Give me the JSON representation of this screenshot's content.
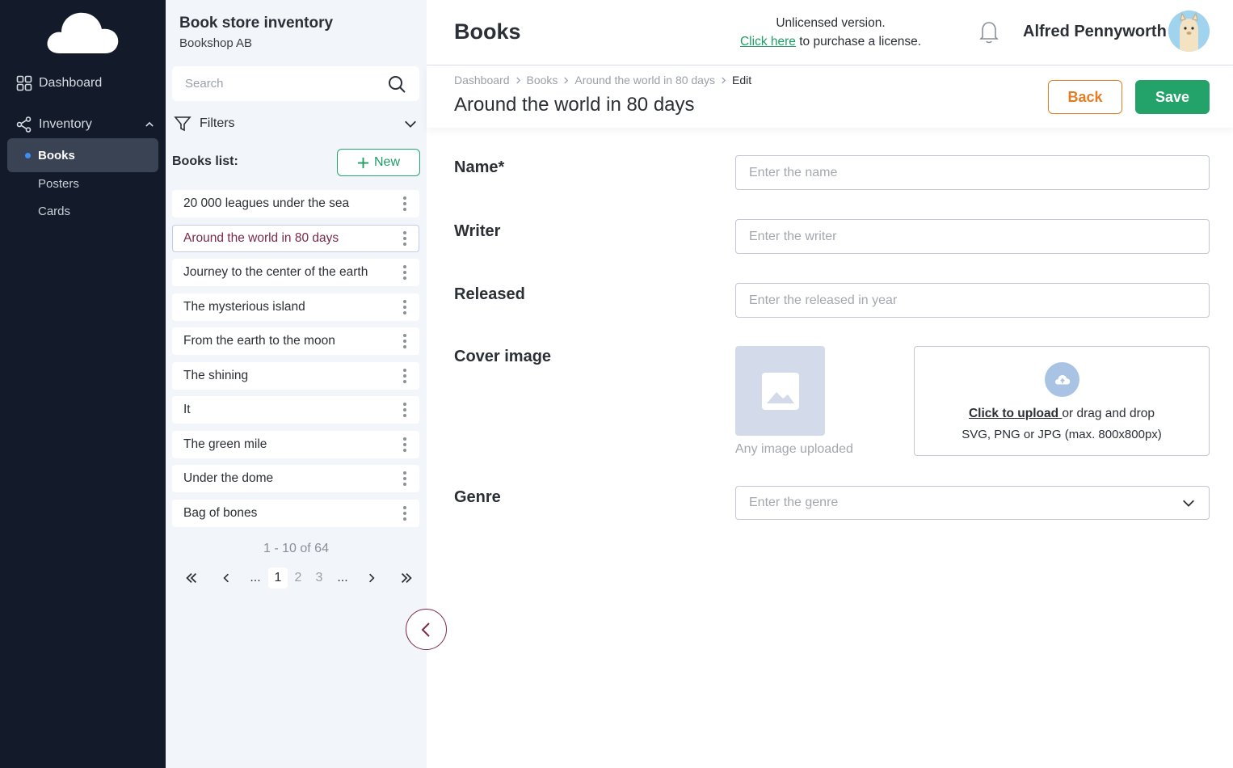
{
  "sidebar": {
    "logo_icon": "cloud-icon",
    "dashboard_label": "Dashboard",
    "inventory_label": "Inventory",
    "sub_items": [
      {
        "label": "Books",
        "active": true
      },
      {
        "label": "Posters",
        "active": false
      },
      {
        "label": "Cards",
        "active": false
      }
    ]
  },
  "list_panel": {
    "title": "Book store inventory",
    "subtitle": "Bookshop AB",
    "search_placeholder": "Search",
    "filters_label": "Filters",
    "list_label": "Books list:",
    "new_label": "New",
    "books": [
      {
        "title": "20 000 leagues under the sea",
        "selected": false
      },
      {
        "title": "Around the world in 80 days",
        "selected": true
      },
      {
        "title": "Journey to the center of the earth",
        "selected": false
      },
      {
        "title": "The mysterious island",
        "selected": false
      },
      {
        "title": "From the earth to the moon",
        "selected": false
      },
      {
        "title": "The shining",
        "selected": false
      },
      {
        "title": "It",
        "selected": false
      },
      {
        "title": "The green mile",
        "selected": false
      },
      {
        "title": "Under the dome",
        "selected": false
      },
      {
        "title": "Bag of bones",
        "selected": false
      }
    ],
    "range_text": "1 - 10 of 64",
    "pagination": {
      "first": "«",
      "prev": "‹",
      "ellipsis": "...",
      "pages": [
        "1",
        "2",
        "3"
      ],
      "current_page": "1",
      "next": "›",
      "last": "»"
    }
  },
  "topbar": {
    "page_title": "Books",
    "license_line1": "Unlicensed version.",
    "license_link": "Click here",
    "license_rest": " to purchase a license.",
    "user_name": "Alfred Pennyworth"
  },
  "record": {
    "breadcrumb": [
      "Dashboard",
      "Books",
      "Around the world in 80 days",
      "Edit"
    ],
    "title": "Around the world in 80 days",
    "back_label": "Back",
    "save_label": "Save"
  },
  "form": {
    "name_label": "Name*",
    "name_placeholder": "Enter the name",
    "writer_label": "Writer",
    "writer_placeholder": "Enter the writer",
    "released_label": "Released",
    "released_placeholder": "Enter the released in year",
    "cover_label": "Cover image",
    "cover_caption": "Any image uploaded",
    "upload_link": "Click to upload ",
    "upload_rest": "or drag and drop",
    "upload_hint": "SVG, PNG or JPG (max. 800x800px)",
    "genre_label": "Genre",
    "genre_placeholder": "Enter the genre"
  },
  "colors": {
    "sidebar_bg": "#131b2a",
    "accent_green": "#23a36a",
    "accent_orange": "#e27d25",
    "selected_text": "#7b2a4a",
    "active_dot": "#3c8ff5"
  }
}
